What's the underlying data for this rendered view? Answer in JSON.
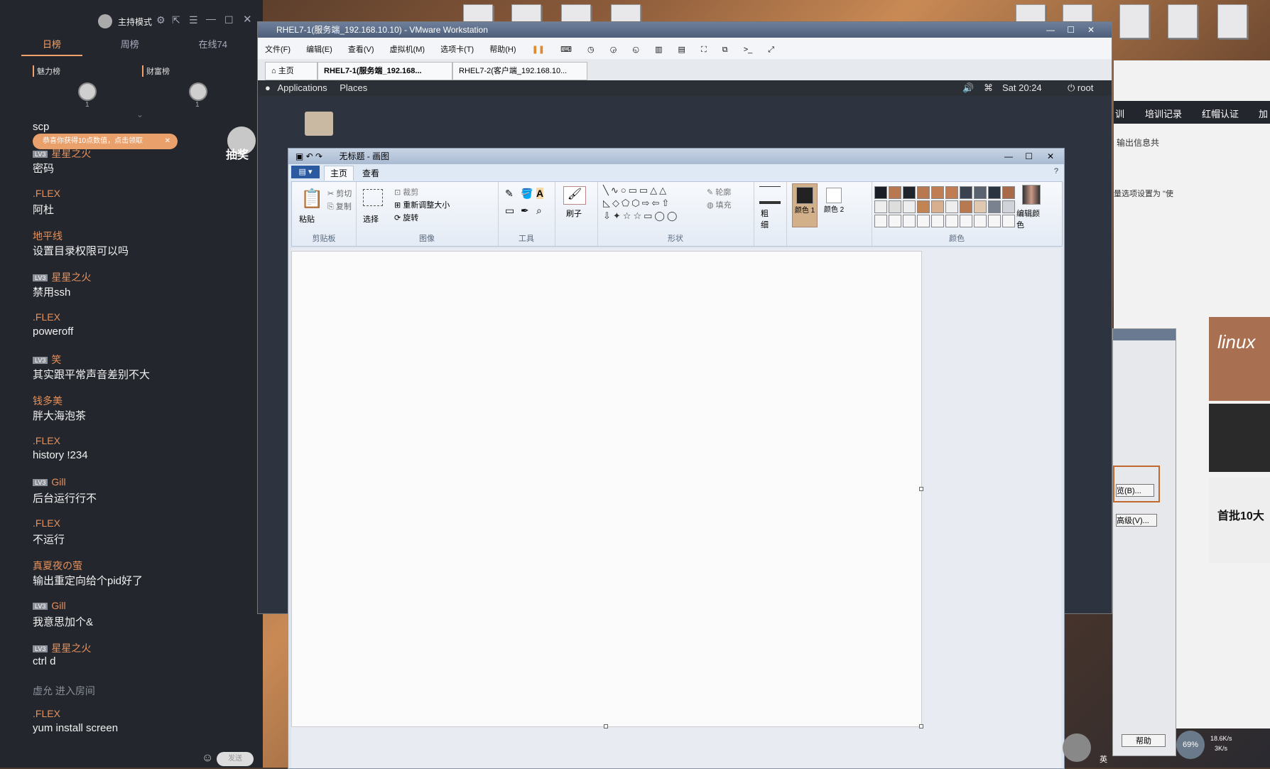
{
  "chat_panel": {
    "host_mode": "主持模式",
    "tabs": [
      "日榜",
      "周榜",
      "在线74"
    ],
    "ranks": [
      {
        "label": "魅力榜",
        "count": "1"
      },
      {
        "label": "财富榜",
        "count": "1"
      }
    ],
    "prompt": "恭喜你获得10点数值，点击领取",
    "lottery": "抽奖",
    "messages": [
      {
        "name": "",
        "text": "scp",
        "lv": false,
        "gray": false
      },
      {
        "name": "星星之火",
        "text": "密码",
        "lv": true
      },
      {
        "name": ".FLEX",
        "text": "阿杜",
        "lv": false
      },
      {
        "name": "地平线",
        "text": "设置目录权限可以吗",
        "lv": false
      },
      {
        "name": "星星之火",
        "text": "禁用ssh",
        "lv": true
      },
      {
        "name": ".FLEX",
        "text": "poweroff",
        "lv": false
      },
      {
        "name": "笑",
        "text": "其实跟平常声音差别不大",
        "lv": true
      },
      {
        "name": "钱多美",
        "text": "胖大海泡茶",
        "lv": false
      },
      {
        "name": ".FLEX",
        "text": "history !234",
        "lv": false
      },
      {
        "name": "Gill",
        "text": "后台运行行不",
        "lv": true
      },
      {
        "name": ".FLEX",
        "text": "不运行",
        "lv": false
      },
      {
        "name": "真夏夜の萤",
        "text": "输出重定向给个pid好了",
        "lv": false
      },
      {
        "name": "Gill",
        "text": "我意思加个&",
        "lv": true
      },
      {
        "name": "星星之火",
        "text": "ctrl d",
        "lv": true
      },
      {
        "name": "",
        "text": "虚允 进入房间",
        "lv": false
      },
      {
        "name": ".FLEX",
        "text": "yum install screen",
        "lv": false
      }
    ],
    "lv_text": "LV3",
    "send_label": "发送"
  },
  "vmware": {
    "title": "RHEL7-1(服务端_192.168.10.10) - VMware Workstation",
    "menu": [
      "文件(F)",
      "编辑(E)",
      "查看(V)",
      "虚拟机(M)",
      "选项卡(T)",
      "帮助(H)"
    ],
    "tabs": [
      "主页",
      "RHEL7-1(服务端_192.168...",
      "RHEL7-2(客户端_192.168.10..."
    ],
    "gnome": {
      "applications": "Applications",
      "places": "Places",
      "clock": "Sat 20:24",
      "user": "root"
    }
  },
  "paint": {
    "title": "无标题 - 画图",
    "tabs": [
      "主页",
      "查看"
    ],
    "clipboard": {
      "paste": "粘贴",
      "cut": "剪切",
      "copy": "复制",
      "caption": "剪贴板"
    },
    "image": {
      "select": "选择",
      "crop": "裁剪",
      "resize": "重新调整大小",
      "rotate": "旋转",
      "caption": "图像"
    },
    "tools": {
      "caption": "工具"
    },
    "brush": "刷子",
    "shapes": {
      "outline": "轮廓",
      "fill": "填充",
      "caption": "形状"
    },
    "size": "粗细",
    "color1": "颜色 1",
    "color2": "颜色 2",
    "edit_colors": "编辑颜色",
    "colors_caption": "颜色",
    "palette": [
      "#1a1e26",
      "#b87850",
      "#20242c",
      "#b87850",
      "#c07c52",
      "#c07c52",
      "#3a4250",
      "#5a6270",
      "#2a3440",
      "#a86a48"
    ]
  },
  "right_panel": {
    "nav": [
      "训",
      "培训记录",
      "红帽认证",
      "加"
    ],
    "lines": [
      "输出信息共",
      "量选项设置为 \"使"
    ],
    "browse": "览(B)...",
    "advanced": "高级(V)...",
    "help": "帮助",
    "banner1": "linux",
    "banner3": "首批10大",
    "net_up": "18.6K/s",
    "net_down": "3K/s",
    "cpu": "69%",
    "ime": "英"
  }
}
